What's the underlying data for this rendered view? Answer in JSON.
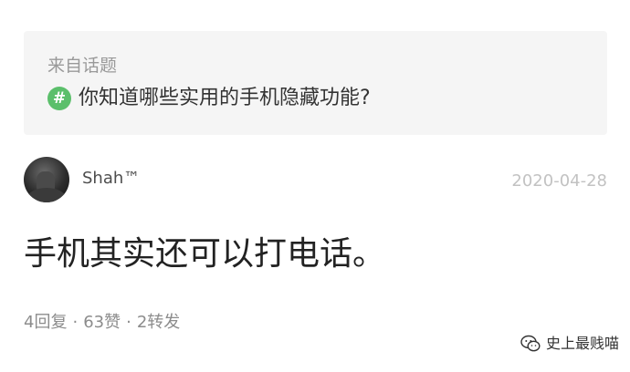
{
  "topic": {
    "source_label": "来自话题",
    "icon": "hash-icon",
    "icon_glyph": "#",
    "title": "你知道哪些实用的手机隐藏功能?"
  },
  "post": {
    "author": "Shah™",
    "date": "2020-04-28",
    "content": "手机其实还可以打电话。",
    "stats": {
      "replies": "4回复",
      "likes": "63赞",
      "reposts": "2转发",
      "separator": "·"
    }
  },
  "watermark": {
    "icon": "wechat-icon",
    "text": "史上最贱喵"
  },
  "colors": {
    "topic_card_bg": "#f5f5f5",
    "hash_icon_bg": "#5bbf6b",
    "date_text": "#c2c2c2",
    "stats_text": "#8c8c8c"
  }
}
